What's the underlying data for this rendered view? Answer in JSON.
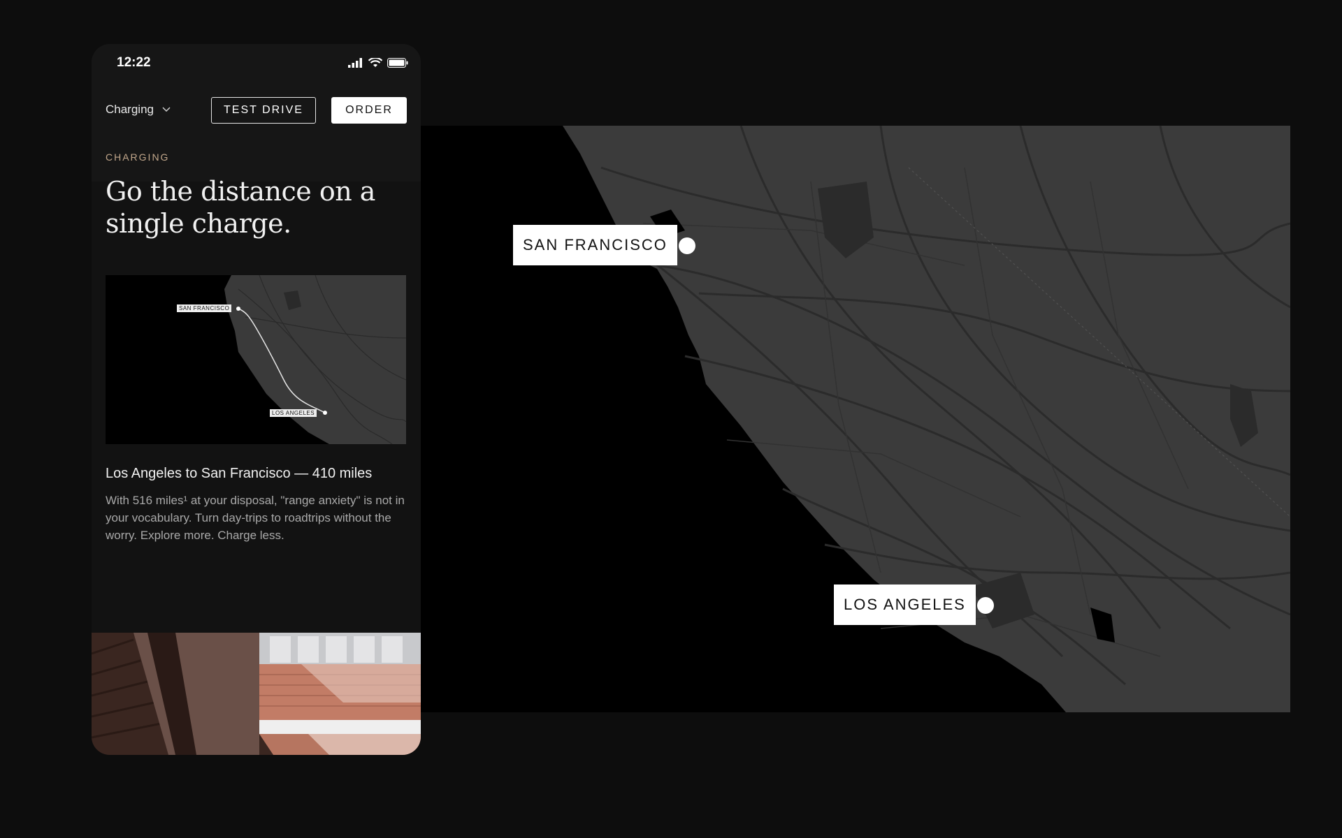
{
  "status_bar": {
    "time": "12:22",
    "icons": [
      "signal-icon",
      "wifi-icon",
      "battery-icon"
    ]
  },
  "nav": {
    "dropdown_label": "Charging",
    "dropdown_icon": "chevron-down-icon",
    "test_drive_label": "TEST DRIVE",
    "order_label": "ORDER"
  },
  "content": {
    "eyebrow": "CHARGING",
    "headline": "Go the distance on a single charge.",
    "thumbnail_labels": {
      "origin": "SAN FRANCISCO",
      "destination": "LOS ANGELES"
    },
    "caption_title": "Los Angeles to San Francisco — 410 miles",
    "caption_body": "With 516 miles¹ at your disposal, \"range anxiety\" is not in your vocabulary. Turn day-trips to roadtrips without the worry.  Explore more. Charge less."
  },
  "map": {
    "origin_label": "SAN FRANCISCO",
    "destination_label": "LOS ANGELES"
  },
  "colors": {
    "page_background": "#0d0d0d",
    "phone_background": "#121212",
    "eyebrow_accent": "#c3a88c",
    "map_land": "#3b3b3b",
    "map_water": "#000000",
    "map_roads": "#2a2a2a"
  }
}
